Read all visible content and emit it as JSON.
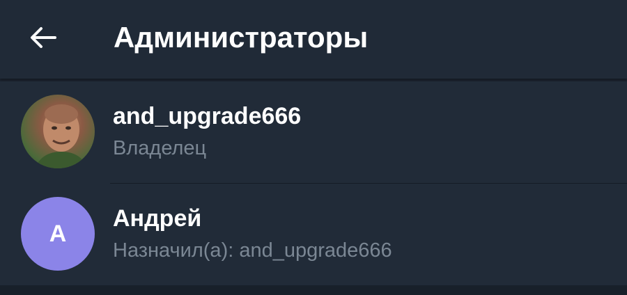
{
  "header": {
    "title": "Администраторы",
    "back_icon": "arrow-left-icon"
  },
  "admins": [
    {
      "name": "and_upgrade666",
      "role": "Владелец",
      "avatar_type": "photo"
    },
    {
      "name": "Андрей",
      "role": "Назначил(а): and_upgrade666",
      "avatar_type": "letter",
      "avatar_letter": "А",
      "avatar_color": "#8b84e8"
    }
  ],
  "colors": {
    "background": "#1c2430",
    "header": "#202a37",
    "text_primary": "#ffffff",
    "text_secondary": "#7b8794"
  }
}
